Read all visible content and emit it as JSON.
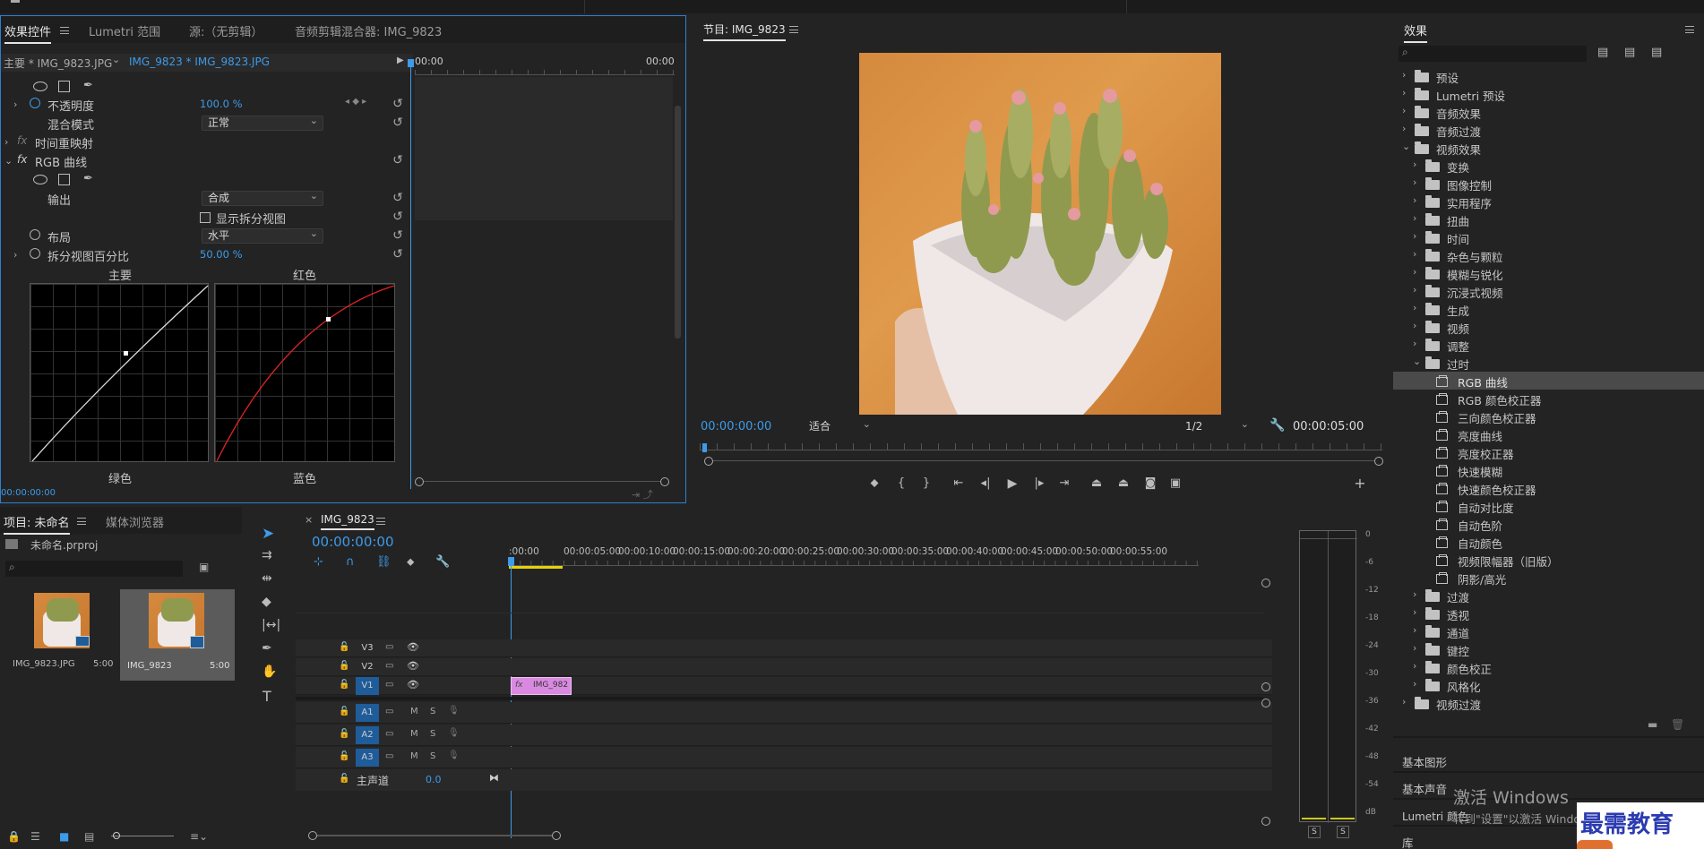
{
  "effect_controls": {
    "tabs": [
      "效果控件",
      "Lumetri 范围",
      "源:（无剪辑）",
      "音频剪辑混合器: IMG_9823"
    ],
    "master_clip": "主要 * IMG_9823.JPG",
    "sequence_clip": "IMG_9823 * IMG_9823.JPG",
    "time_start": "00:00",
    "time_end": "00:00",
    "opacity_label": "不透明度",
    "opacity_value": "100.0 %",
    "blend_label": "混合模式",
    "blend_value": "正常",
    "time_remap_label": "时间重映射",
    "rgb_curves_label": "RGB 曲线",
    "output_label": "输出",
    "output_value": "合成",
    "split_view_label": "显示拆分视图",
    "layout_label": "布局",
    "layout_value": "水平",
    "split_pct_label": "拆分视图百分比",
    "split_pct_value": "50.00 %",
    "curve_master": "主要",
    "curve_red": "红色",
    "curve_green": "绿色",
    "curve_blue": "蓝色",
    "timecode": "00:00:00:00"
  },
  "program": {
    "title": "节目: IMG_9823",
    "timecode": "00:00:00:00",
    "fit": "适合",
    "resolution": "1/2",
    "duration": "00:00:05:00"
  },
  "project": {
    "tabs": [
      "项目: 未命名",
      "媒体浏览器"
    ],
    "file": "未命名.prproj",
    "items": [
      {
        "name": "IMG_9823.JPG",
        "duration": "5:00"
      },
      {
        "name": "IMG_9823",
        "duration": "5:00"
      }
    ]
  },
  "timeline": {
    "tab": "IMG_9823",
    "timecode": "00:00:00:00",
    "ruler": [
      ":00:00",
      "00:00:05:00",
      "00:00:10:00",
      "00:00:15:00",
      "00:00:20:00",
      "00:00:25:00",
      "00:00:30:00",
      "00:00:35:00",
      "00:00:40:00",
      "00:00:45:00",
      "00:00:50:00",
      "00:00:55:00"
    ],
    "video_tracks": [
      "V3",
      "V2",
      "V1"
    ],
    "audio_tracks": [
      "A1",
      "A2",
      "A3"
    ],
    "mute": "M",
    "solo": "S",
    "master_label": "主声道",
    "master_value": "0.0",
    "clip_label": "IMG_982",
    "clip_fx": "fx"
  },
  "audio_meter": {
    "scale": [
      "0",
      "-6",
      "-12",
      "-18",
      "-24",
      "-30",
      "-36",
      "-42",
      "-48",
      "-54",
      "dB"
    ],
    "solo_left": "S",
    "solo_right": "S"
  },
  "effects": {
    "title": "效果",
    "tree": [
      {
        "label": "预设",
        "level": 0,
        "icon": "folder-star",
        "open": false
      },
      {
        "label": "Lumetri 预设",
        "level": 0,
        "icon": "folder-star",
        "open": false
      },
      {
        "label": "音频效果",
        "level": 0,
        "icon": "folder",
        "open": false
      },
      {
        "label": "音频过渡",
        "level": 0,
        "icon": "folder",
        "open": false
      },
      {
        "label": "视频效果",
        "level": 0,
        "icon": "folder",
        "open": true
      },
      {
        "label": "变换",
        "level": 1,
        "icon": "folder",
        "open": false
      },
      {
        "label": "图像控制",
        "level": 1,
        "icon": "folder",
        "open": false
      },
      {
        "label": "实用程序",
        "level": 1,
        "icon": "folder",
        "open": false
      },
      {
        "label": "扭曲",
        "level": 1,
        "icon": "folder",
        "open": false
      },
      {
        "label": "时间",
        "level": 1,
        "icon": "folder",
        "open": false
      },
      {
        "label": "杂色与颗粒",
        "level": 1,
        "icon": "folder",
        "open": false
      },
      {
        "label": "模糊与锐化",
        "level": 1,
        "icon": "folder",
        "open": false
      },
      {
        "label": "沉浸式视频",
        "level": 1,
        "icon": "folder",
        "open": false
      },
      {
        "label": "生成",
        "level": 1,
        "icon": "folder",
        "open": false
      },
      {
        "label": "视频",
        "level": 1,
        "icon": "folder",
        "open": false
      },
      {
        "label": "调整",
        "level": 1,
        "icon": "folder",
        "open": false
      },
      {
        "label": "过时",
        "level": 1,
        "icon": "folder",
        "open": true
      },
      {
        "label": "RGB 曲线",
        "level": 2,
        "icon": "effect",
        "selected": true
      },
      {
        "label": "RGB 颜色校正器",
        "level": 2,
        "icon": "effect"
      },
      {
        "label": "三向颜色校正器",
        "level": 2,
        "icon": "effect"
      },
      {
        "label": "亮度曲线",
        "level": 2,
        "icon": "effect"
      },
      {
        "label": "亮度校正器",
        "level": 2,
        "icon": "effect"
      },
      {
        "label": "快速模糊",
        "level": 2,
        "icon": "effect"
      },
      {
        "label": "快速颜色校正器",
        "level": 2,
        "icon": "effect"
      },
      {
        "label": "自动对比度",
        "level": 2,
        "icon": "effect"
      },
      {
        "label": "自动色阶",
        "level": 2,
        "icon": "effect"
      },
      {
        "label": "自动颜色",
        "level": 2,
        "icon": "effect"
      },
      {
        "label": "视频限幅器（旧版）",
        "level": 2,
        "icon": "effect"
      },
      {
        "label": "阴影/高光",
        "level": 2,
        "icon": "effect"
      },
      {
        "label": "过渡",
        "level": 1,
        "icon": "folder",
        "open": false
      },
      {
        "label": "透视",
        "level": 1,
        "icon": "folder",
        "open": false
      },
      {
        "label": "通道",
        "level": 1,
        "icon": "folder",
        "open": false
      },
      {
        "label": "键控",
        "level": 1,
        "icon": "folder",
        "open": false
      },
      {
        "label": "颜色校正",
        "level": 1,
        "icon": "folder",
        "open": false
      },
      {
        "label": "风格化",
        "level": 1,
        "icon": "folder",
        "open": false
      },
      {
        "label": "视频过渡",
        "level": 0,
        "icon": "folder",
        "open": false
      }
    ],
    "bottom_panels": [
      "基本图形",
      "基本声音",
      "Lumetri 颜色",
      "库"
    ]
  },
  "watermark": {
    "activate_title": "激活 Windows",
    "activate_sub": "转到\"设置\"以激活 Windows。",
    "brand": "最需教育"
  },
  "colors": {
    "accent": "#3d9be9",
    "panel_bg": "#232323",
    "clip": "#d98ae0",
    "track_blue": "#1f5c9a",
    "panel_focus": "#2e7fd6"
  }
}
